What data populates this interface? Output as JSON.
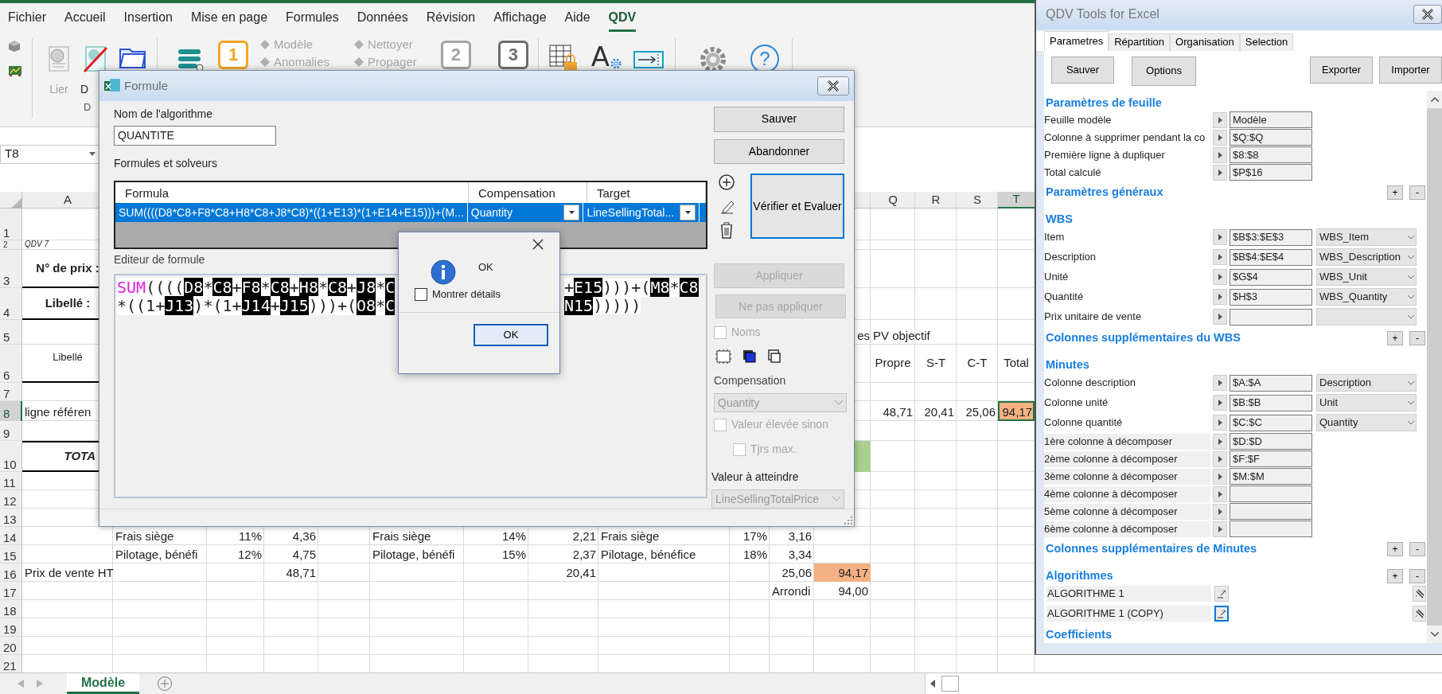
{
  "ribbon": {
    "tabs": [
      {
        "label": "Fichier",
        "selected": false
      },
      {
        "label": "Accueil",
        "selected": false
      },
      {
        "label": "Insertion",
        "selected": false
      },
      {
        "label": "Mise en page",
        "selected": false
      },
      {
        "label": "Formules",
        "selected": false
      },
      {
        "label": "Données",
        "selected": false
      },
      {
        "label": "Révision",
        "selected": false
      },
      {
        "label": "Affichage",
        "selected": false
      },
      {
        "label": "Aide",
        "selected": false
      },
      {
        "label": "QDV",
        "selected": true
      }
    ],
    "large_buttons": [
      {
        "label": "Lier",
        "disabled": true
      },
      {
        "label": "D",
        "disabled": false
      }
    ],
    "group_label": "D",
    "step_boxes": [
      {
        "text": "1",
        "color": "#f5a623"
      },
      {
        "text": "2",
        "color": "#a3a3a3"
      },
      {
        "text": "3",
        "color": "#6e6e6e"
      }
    ],
    "small_commands": [
      {
        "label": "Modèle",
        "disabled": true
      },
      {
        "label": "Anomalies",
        "disabled": true
      },
      {
        "label": "Nettoyer",
        "disabled": true
      },
      {
        "label": "Propager",
        "disabled": true
      }
    ],
    "font_glyph": "A",
    "help_glyph": "?"
  },
  "name_box": "T8",
  "sheet": {
    "columns": [
      {
        "letter": "A",
        "selected": false
      },
      {
        "letter": "Q",
        "selected": false
      },
      {
        "letter": "R",
        "selected": false
      },
      {
        "letter": "S",
        "selected": false
      },
      {
        "letter": "T",
        "selected": true
      }
    ],
    "rows": [
      {
        "number": "1",
        "selected": false
      },
      {
        "number": "2",
        "selected": false,
        "cells": [
          {
            "text": "QDV 7",
            "kind": "note"
          }
        ]
      },
      {
        "number": "3",
        "selected": false,
        "cells": [
          {
            "text": "N° de prix :",
            "kind": "label"
          }
        ]
      },
      {
        "number": "4",
        "selected": false,
        "cells": [
          {
            "text": "Libellé :",
            "kind": "label"
          }
        ]
      },
      {
        "number": "5",
        "selected": false,
        "cells": [
          null,
          null,
          null,
          null,
          null,
          null,
          null,
          null,
          null,
          null,
          null,
          {
            "text": "es",
            "kind": "tail"
          },
          "PV objectif"
        ]
      },
      {
        "number": "6",
        "selected": false,
        "cells": [
          {
            "text": "Libellé",
            "kind": "caption"
          },
          null,
          null,
          null,
          null,
          null,
          null,
          null,
          null,
          null,
          null,
          null,
          {
            "text": "Propre",
            "kind": "heading"
          },
          {
            "text": "S-T",
            "kind": "heading"
          },
          {
            "text": "C-T",
            "kind": "heading"
          },
          {
            "text": "Total",
            "kind": "heading"
          }
        ]
      },
      {
        "number": "7",
        "selected": false
      },
      {
        "number": "8",
        "selected": true,
        "cells": [
          "ligne référen",
          null,
          null,
          null,
          null,
          null,
          null,
          null,
          null,
          null,
          null,
          null,
          {
            "text": "48,71",
            "kind": "number"
          },
          {
            "text": "20,41",
            "kind": "number"
          },
          {
            "text": "25,06",
            "kind": "number"
          },
          {
            "text": "94,17",
            "kind": "number",
            "color": "#f4b183",
            "selected": true
          }
        ]
      },
      {
        "number": "9",
        "selected": false
      },
      {
        "number": "10",
        "selected": false,
        "cells": [
          {
            "text": "TOTA",
            "kind": "total"
          },
          null,
          null,
          null,
          null,
          null,
          null,
          null,
          null,
          null,
          null,
          {
            "kind": "fill",
            "color": "#a9d08e"
          }
        ]
      },
      {
        "number": "11",
        "selected": false
      },
      {
        "number": "12",
        "selected": false
      },
      {
        "number": "13",
        "selected": false
      },
      {
        "number": "14",
        "selected": false,
        "cells": [
          null,
          "Frais siège",
          {
            "text": "11%",
            "kind": "number"
          },
          {
            "text": "4,36",
            "kind": "number"
          },
          null,
          "Frais siège",
          {
            "text": "14%",
            "kind": "number"
          },
          {
            "text": "2,21",
            "kind": "number"
          },
          "Frais siège",
          {
            "text": "17%",
            "kind": "number"
          },
          {
            "text": "3,16",
            "kind": "number"
          }
        ]
      },
      {
        "number": "15",
        "selected": false,
        "cells": [
          null,
          "Pilotage, bénéfi",
          {
            "text": "12%",
            "kind": "number"
          },
          {
            "text": "4,75",
            "kind": "number"
          },
          null,
          "Pilotage, bénéfi",
          {
            "text": "15%",
            "kind": "number"
          },
          {
            "text": "2,37",
            "kind": "number"
          },
          "Pilotage, bénéfice",
          {
            "text": "18%",
            "kind": "number"
          },
          {
            "text": "3,34",
            "kind": "number"
          }
        ]
      },
      {
        "number": "16",
        "selected": false,
        "cells": [
          "Prix de vente HT",
          null,
          null,
          {
            "text": "48,71",
            "kind": "number"
          },
          null,
          null,
          null,
          {
            "text": "20,41",
            "kind": "number"
          },
          null,
          null,
          {
            "text": "25,06",
            "kind": "number"
          },
          {
            "text": "94,17",
            "kind": "number",
            "color": "#f4b183"
          }
        ]
      },
      {
        "number": "17",
        "selected": false,
        "cells": [
          null,
          null,
          null,
          null,
          null,
          null,
          null,
          null,
          null,
          null,
          "Arrondi",
          {
            "text": "94,00",
            "kind": "number"
          }
        ]
      },
      {
        "number": "18",
        "selected": false
      },
      {
        "number": "19",
        "selected": false
      },
      {
        "number": "20",
        "selected": false
      },
      {
        "number": "21",
        "selected": false
      }
    ]
  },
  "sheet_tabs": [
    {
      "label": "Modèle",
      "selected": true
    }
  ],
  "formula_dialog": {
    "title": "Formule",
    "name_label": "Nom de l'algorithme",
    "name_value": "QUANTITE",
    "grid_label": "Formules et solveurs",
    "grid": {
      "columns": [
        "Formula",
        "Compensation",
        "Target"
      ],
      "rows": [
        {
          "formula": "SUM((((D8*C8+F8*C8+H8*C8+J8*C8)*((1+E13)*(1+E14+E15)))+(M...",
          "compensation": "Quantity",
          "target": "LineSellingTotal...",
          "selected": true
        }
      ]
    },
    "editor_label": "Editeur de formule",
    "editor_lines": [
      {
        "left": "SUM((((D8*C8+F8*C8+H8*C8+J8*C",
        "right": "+E15)))+(M8*C8"
      },
      {
        "left": "*((1+J13)*(1+J14+J15)))+(O8*C",
        "right": "N15)))))"
      }
    ],
    "buttons": [
      {
        "label": "Sauver",
        "disabled": false
      },
      {
        "label": "Abandonner",
        "disabled": false
      },
      {
        "label": "Vérifier et Evaluer",
        "disabled": false
      },
      {
        "label": "Appliquer",
        "disabled": true
      },
      {
        "label": "Ne pas appliquer",
        "disabled": true
      }
    ],
    "checkboxes": [
      {
        "label": "Noms",
        "checked": false,
        "disabled": true
      },
      {
        "label": "Valeur élevée sinon",
        "checked": false,
        "disabled": true
      },
      {
        "label": "Tjrs max.",
        "checked": false,
        "disabled": true
      }
    ],
    "compensation": {
      "label": "Compensation",
      "value": "Quantity",
      "disabled": true
    },
    "target": {
      "label": "Valeur à atteindre",
      "value": "LineSellingTotalPrice",
      "disabled": true
    }
  },
  "message_box": {
    "text": "OK",
    "checkbox": {
      "label": "Montrer détails",
      "checked": false
    },
    "button": "OK"
  },
  "tools_panel": {
    "title": "QDV Tools for Excel",
    "tabs": [
      {
        "label": "Parametres",
        "selected": true
      },
      {
        "label": "Répartition",
        "selected": false
      },
      {
        "label": "Organisation",
        "selected": false
      },
      {
        "label": "Selection",
        "selected": false
      }
    ],
    "buttons": [
      "Sauver",
      "Options",
      "Exporter",
      "Importer"
    ],
    "sections": [
      {
        "title": "Paramètres de feuille",
        "rows": [
          {
            "kind": "field",
            "label": "Feuille modèle",
            "value": "Modèle"
          },
          {
            "kind": "field",
            "label": "Colonne à supprimer pendant la co",
            "value": "$Q:$Q"
          },
          {
            "kind": "field",
            "label": "Première ligne à dupliquer",
            "value": "$8:$8"
          },
          {
            "kind": "field",
            "label": "Total calculé",
            "value": "$P$16"
          }
        ]
      },
      {
        "title": "Paramètres généraux",
        "buttons": [
          "+",
          "-"
        ]
      },
      {
        "title": "WBS",
        "rows": [
          {
            "kind": "combo",
            "label": "Item",
            "value": "$B$3:$E$3",
            "choice": "WBS_Item"
          },
          {
            "kind": "combo",
            "label": "Description",
            "value": "$B$4:$E$4",
            "choice": "WBS_Description"
          },
          {
            "kind": "combo",
            "label": "Unité",
            "value": "$G$4",
            "choice": "WBS_Unit"
          },
          {
            "kind": "combo",
            "label": "Quantité",
            "value": "$H$3",
            "choice": "WBS_Quantity"
          },
          {
            "kind": "combo",
            "label": "Prix unitaire de vente"
          }
        ]
      },
      {
        "title": "Colonnes supplémentaires du WBS",
        "buttons": [
          "+",
          "-"
        ]
      },
      {
        "title": "Minutes",
        "rows": [
          {
            "kind": "combo",
            "label": "Colonne description",
            "value": "$A:$A",
            "choice": "Description"
          },
          {
            "kind": "combo",
            "label": "Colonne unité",
            "value": "$B:$B",
            "choice": "Unit"
          },
          {
            "kind": "combo",
            "label": "Colonne quantité",
            "value": "$C:$C",
            "choice": "Quantity"
          },
          {
            "kind": "shaded",
            "label": "1ère colonne à décomposer",
            "value": "$D:$D"
          },
          {
            "kind": "shaded",
            "label": "2ème colonne à décomposer",
            "value": "$F:$F"
          },
          {
            "kind": "shaded",
            "label": "3ème colonne à décomposer",
            "value": "$M:$M"
          },
          {
            "kind": "shaded",
            "label": "4ème colonne à décomposer"
          },
          {
            "kind": "shaded",
            "label": "5ème colonne à décomposer"
          },
          {
            "kind": "shaded",
            "label": "6ème colonne à décomposer"
          }
        ]
      },
      {
        "title": "Colonnes supplémentaires de Minutes",
        "buttons": [
          "+",
          "-"
        ]
      },
      {
        "title": "Algorithmes",
        "buttons": [
          "+",
          "-"
        ],
        "algorithms": [
          {
            "name": "ALGORITHME 1",
            "selected": false
          },
          {
            "name": "ALGORITHME 1 (COPY)",
            "selected": true
          }
        ]
      },
      {
        "title": "Coefficients"
      }
    ]
  }
}
